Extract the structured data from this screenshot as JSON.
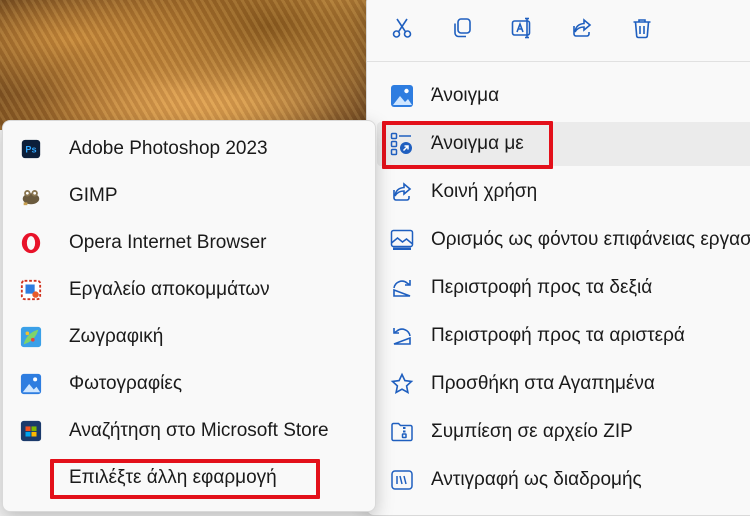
{
  "action_bar": {
    "cut": "cut-icon",
    "copy": "copy-icon",
    "rename": "rename-icon",
    "share": "share-icon",
    "delete": "delete-icon"
  },
  "menu": {
    "items": [
      {
        "label": "Άνοιγμα",
        "icon": "photos-icon"
      },
      {
        "label": "Άνοιγμα με",
        "icon": "open-with-icon"
      },
      {
        "label": "Κοινή χρήση",
        "icon": "share-icon"
      },
      {
        "label": "Ορισμός ως φόντου επιφάνειας εργασίας",
        "icon": "wallpaper-icon"
      },
      {
        "label": "Περιστροφή προς τα δεξιά",
        "icon": "rotate-right-icon"
      },
      {
        "label": "Περιστροφή προς τα αριστερά",
        "icon": "rotate-left-icon"
      },
      {
        "label": "Προσθήκη στα Αγαπημένα",
        "icon": "star-icon"
      },
      {
        "label": "Συμπίεση σε αρχείο ZIP",
        "icon": "zip-icon"
      },
      {
        "label": "Αντιγραφή ως διαδρομής",
        "icon": "copy-path-icon"
      }
    ]
  },
  "submenu": {
    "items": [
      {
        "label": "Adobe Photoshop 2023",
        "icon": "photoshop-icon"
      },
      {
        "label": "GIMP",
        "icon": "gimp-icon"
      },
      {
        "label": "Opera Internet Browser",
        "icon": "opera-icon"
      },
      {
        "label": "Εργαλείο αποκομμάτων",
        "icon": "snipping-tool-icon"
      },
      {
        "label": "Ζωγραφική",
        "icon": "paint-icon"
      },
      {
        "label": "Φωτογραφίες",
        "icon": "photos-icon"
      },
      {
        "label": "Αναζήτηση στο Microsoft Store",
        "icon": "store-icon"
      },
      {
        "label": "Επιλέξτε άλλη εφαρμογή",
        "icon": ""
      }
    ]
  },
  "colors": {
    "accent": "#1f5fbf",
    "highlight_border": "#e3101a"
  }
}
